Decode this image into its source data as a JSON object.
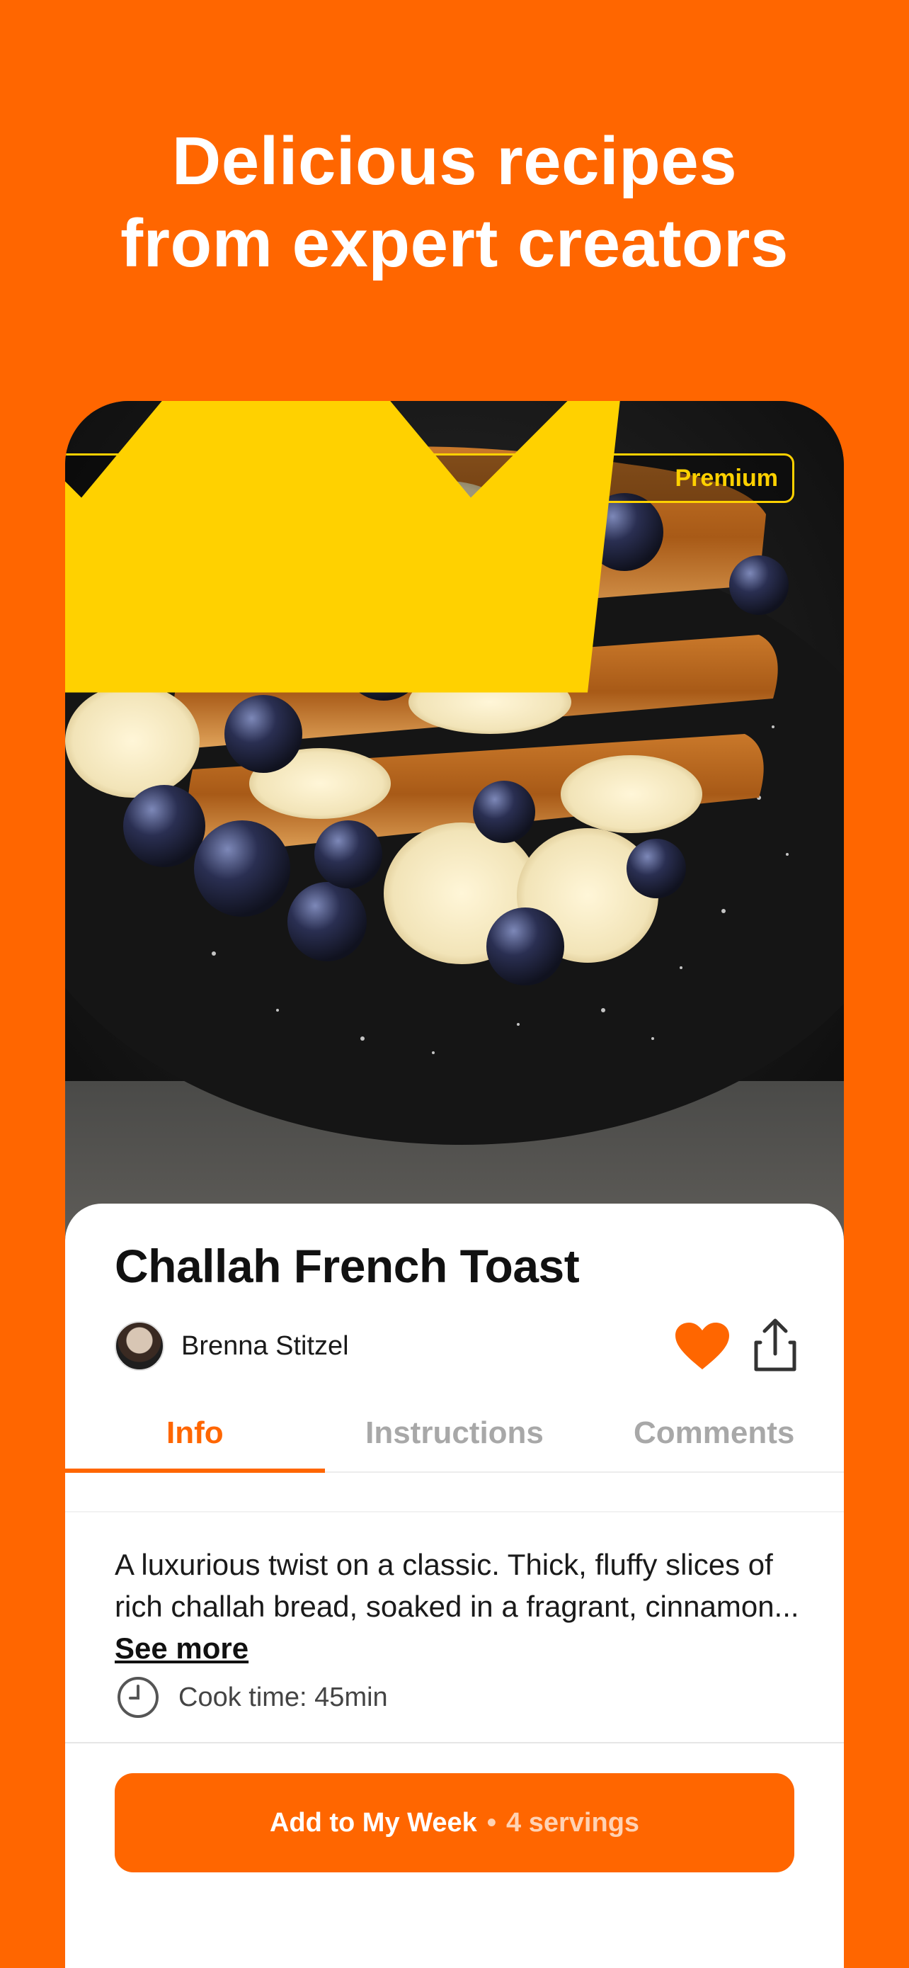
{
  "headline": {
    "line1": "Delicious recipes",
    "line2": "from expert creators"
  },
  "colors": {
    "brand": "#FF6600",
    "premium": "#FFD100",
    "heart": "#FF6600"
  },
  "hero": {
    "back_icon": "chevron-left-icon",
    "premium_icon": "crown-icon",
    "premium_label": "Premium"
  },
  "recipe": {
    "title": "Challah French Toast",
    "author": "Brenna Stitzel",
    "favorited": true,
    "description": "A luxurious twist on a classic. Thick, fluffy slices of rich challah bread, soaked in a fragrant, cinnamon...",
    "see_more": "See more",
    "cook_time": "Cook time: 45min"
  },
  "tabs": [
    {
      "label": "Info",
      "active": true
    },
    {
      "label": "Instructions",
      "active": false
    },
    {
      "label": "Comments",
      "active": false
    }
  ],
  "cta": {
    "label": "Add to My Week",
    "separator": "•",
    "servings": "4 servings"
  }
}
